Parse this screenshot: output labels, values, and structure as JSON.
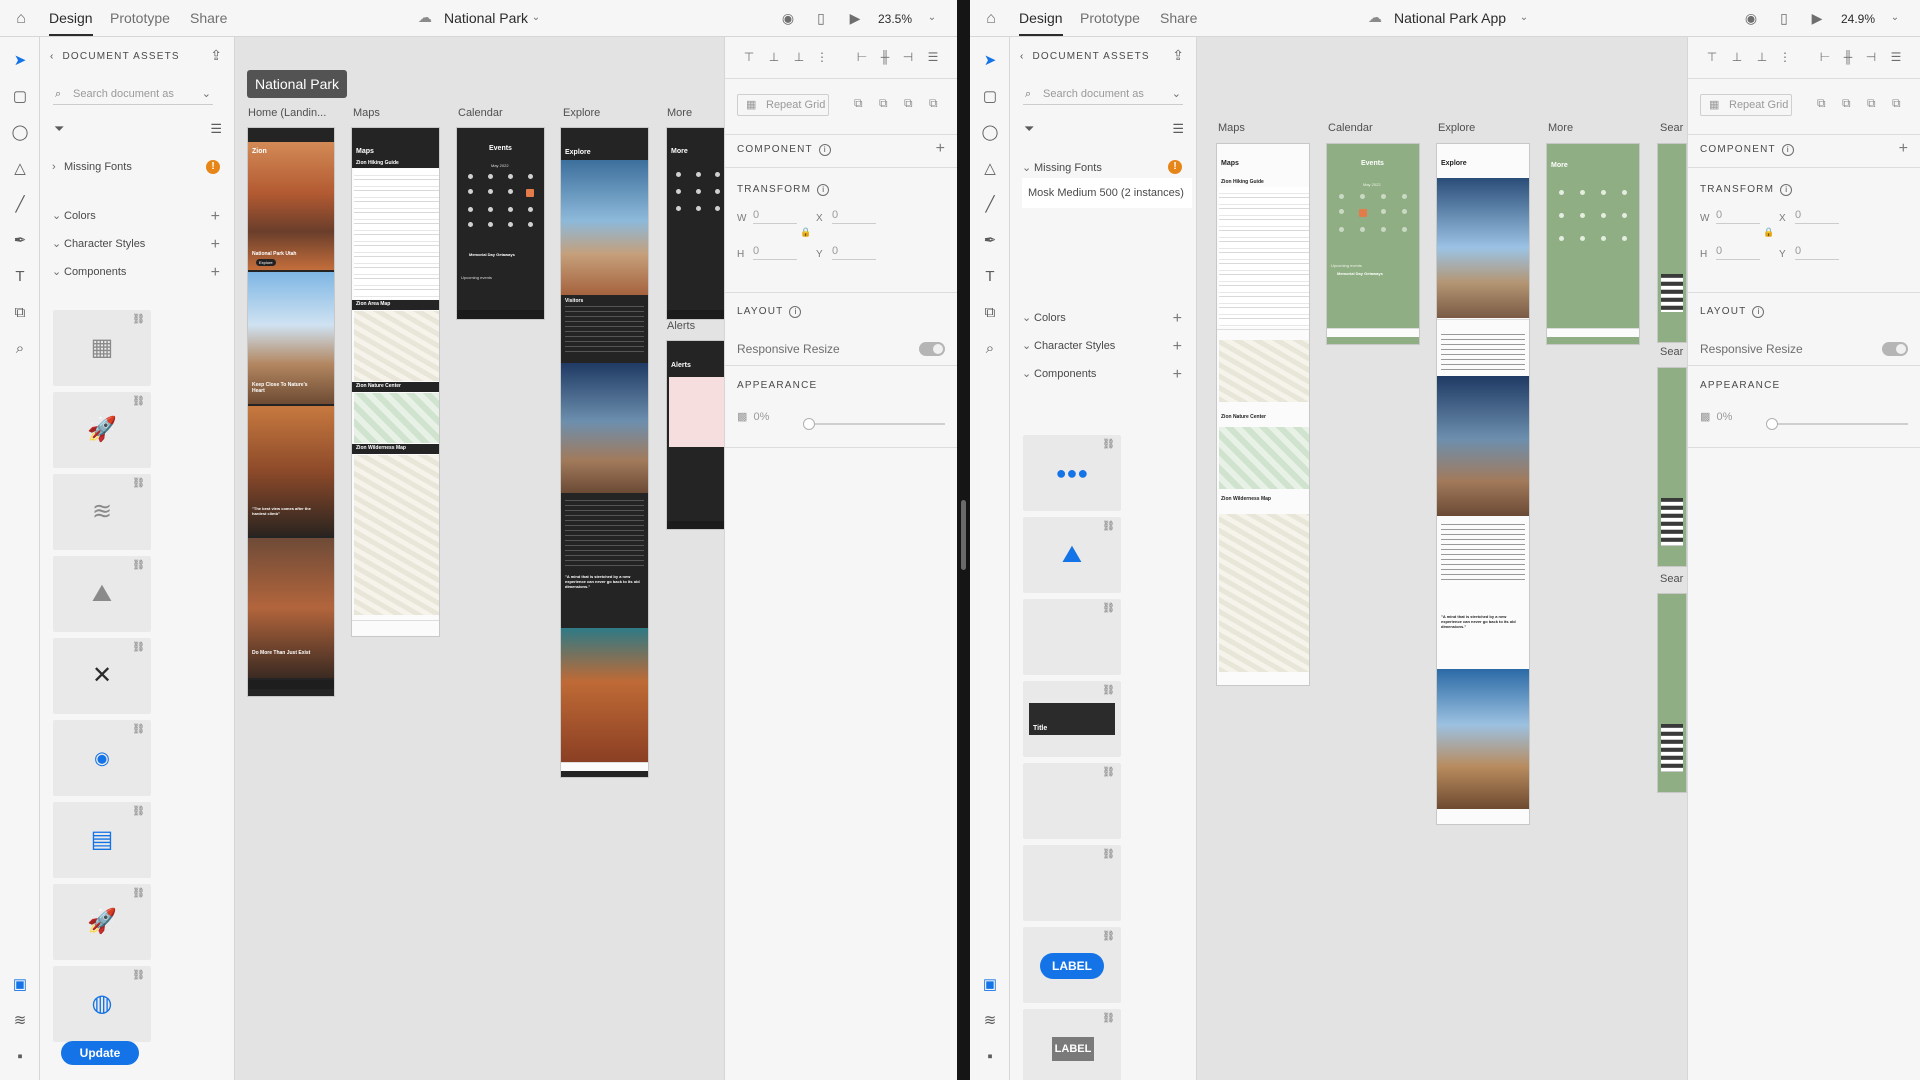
{
  "colors": {
    "accent": "#1473e6",
    "warning": "#e68619",
    "panel": "#f6f6f6",
    "canvas": "#e3e3e3"
  },
  "left": {
    "tabs": [
      "Design",
      "Prototype",
      "Share"
    ],
    "doc_title": "National Park",
    "zoom": "23.5%",
    "assets_header": "DOCUMENT ASSETS",
    "search_placeholder": "Search document as",
    "missing_fonts": "Missing Fonts",
    "colors_label": "Colors",
    "char_styles_label": "Character Styles",
    "components_label": "Components",
    "update_label": "Update",
    "project_name": "National Park",
    "artboards": {
      "home": "Home (Landin...",
      "maps": "Maps",
      "calendar": "Calendar",
      "explore": "Explore",
      "more": "More",
      "alerts": "Alerts"
    },
    "screens": {
      "zion": "Zion",
      "np_utah": "National Park Utah",
      "explore_btn": "Explore",
      "keep_close": "Keep Close To Nature's Heart",
      "quote1": "\"The best view comes after the hardest climb\"",
      "do_more": "Do More Than Just Exist",
      "maps_title": "Maps",
      "hiking_guide": "Zion Hiking Guide",
      "area_map": "Zion Area Map",
      "nature_center": "Zion Nature Center",
      "wilderness_map": "Zion Wilderness Map",
      "events_title": "Events",
      "month": "May 2022",
      "upcoming": "Upcoming events",
      "memorial": "Memorial Day Getaways",
      "explore_title": "Explore",
      "visitors": "Visitors",
      "quote2": "\"A mind that is stretched by a new experience can never go back to its old dimensions.\"",
      "more_title": "More",
      "alerts_title": "Alerts"
    },
    "icons": {
      "home": "home-icon",
      "cloud": "cloud-icon",
      "user": "user-icon",
      "device": "mobile-device-icon",
      "play": "play-icon",
      "chevron": "chevron-down-icon"
    }
  },
  "props": {
    "repeat_grid": "Repeat Grid",
    "component": "COMPONENT",
    "transform": "TRANSFORM",
    "w": "W",
    "h": "H",
    "x": "X",
    "y": "Y",
    "zero": "0",
    "layout": "LAYOUT",
    "responsive": "Responsive Resize",
    "appearance": "APPEARANCE",
    "opacity": "0%"
  },
  "right": {
    "tabs": [
      "Design",
      "Prototype",
      "Share"
    ],
    "doc_title": "National Park App",
    "zoom": "24.9%",
    "assets_header": "DOCUMENT ASSETS",
    "search_placeholder": "Search document as",
    "missing_fonts": "Missing Fonts",
    "font_instance": "Mosk Medium 500 (2 instances)",
    "colors_label": "Colors",
    "char_styles_label": "Character Styles",
    "components_label": "Components",
    "comp_title": "Title",
    "comp_label1": "LABEL",
    "comp_label2": "LABEL",
    "artboards": {
      "maps": "Maps",
      "calendar": "Calendar",
      "explore": "Explore",
      "more": "More",
      "sear1": "Sear",
      "sear2": "Sear",
      "sear3": "Sear"
    },
    "screens": {
      "maps_title": "Maps",
      "hiking_guide": "Zion Hiking Guide",
      "nature_center": "Zion Nature Center",
      "wilderness_map": "Zion Wilderness Map",
      "events_title": "Events",
      "month": "May 2022",
      "upcoming": "Upcoming events",
      "memorial": "Memorial Day Getaways",
      "explore_title": "Explore",
      "quote": "\"A mind that is stretched by a new experience can never go back to its old dimensions.\"",
      "more_title": "More"
    }
  }
}
